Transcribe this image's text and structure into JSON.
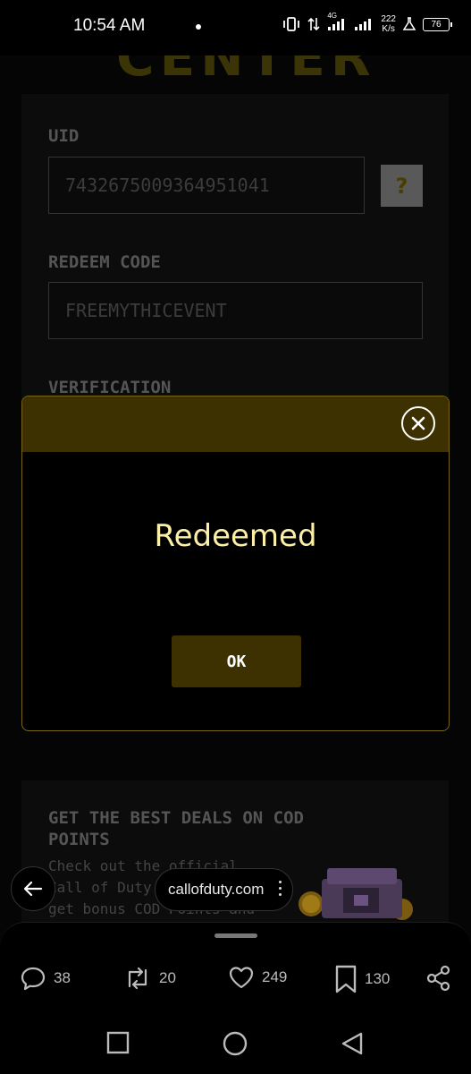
{
  "status_bar": {
    "time": "10:54 AM",
    "network": "4G",
    "speed_value": "222",
    "speed_unit": "K/s",
    "battery": "76"
  },
  "page": {
    "title": "CENTER",
    "uid_label": "UID",
    "uid_value": "7432675009364951041",
    "help_label": "?",
    "redeem_label": "REDEEM CODE",
    "redeem_value": "FREEMYTHICEVENT",
    "verification_label": "VERIFICATION",
    "deals_title": "GET THE BEST DEALS ON COD POINTS",
    "deals_text": "Check out the official Call of Duty: Mobile ... get bonus COD Points and"
  },
  "modal": {
    "message": "Redeemed",
    "ok_label": "OK"
  },
  "browser": {
    "url": "callofduty.com"
  },
  "actions": {
    "replies": "38",
    "reposts": "20",
    "likes": "249",
    "bookmarks": "130"
  },
  "colors": {
    "accent": "#3d3101",
    "modal_border": "#7a6515",
    "message": "#fcefa6"
  }
}
